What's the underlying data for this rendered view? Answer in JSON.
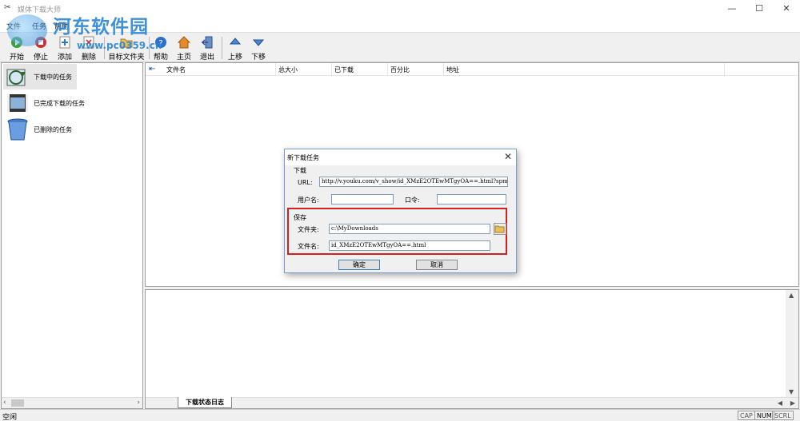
{
  "window": {
    "title": "媒体下载大师",
    "watermark": "河东软件园",
    "watermark_url": "www.pc0359.cn",
    "controls": [
      "—",
      "☐",
      "✕"
    ]
  },
  "menu": [
    "文件",
    "任务",
    "帮助"
  ],
  "toolbar": [
    {
      "label": "开始",
      "icon": "start-icon"
    },
    {
      "label": "停止",
      "icon": "stop-icon"
    },
    {
      "label": "添加",
      "icon": "add-icon"
    },
    {
      "label": "删除",
      "icon": "delete-icon"
    },
    {
      "label": "目标文件夹",
      "icon": "folder-icon"
    },
    {
      "label": "帮助",
      "icon": "help-icon"
    },
    {
      "label": "主页",
      "icon": "home-icon"
    },
    {
      "label": "退出",
      "icon": "exit-icon"
    },
    {
      "label": "上移",
      "icon": "up-arrow-icon"
    },
    {
      "label": "下移",
      "icon": "down-arrow-icon"
    }
  ],
  "sidebar": {
    "items": [
      {
        "label": "下载中的任务",
        "selected": true
      },
      {
        "label": "已完成下载的任务",
        "selected": false
      },
      {
        "label": "已删除的任务",
        "selected": false
      }
    ]
  },
  "list": {
    "columns": [
      "文件名",
      "总大小",
      "已下载",
      "百分比",
      "地址"
    ]
  },
  "log": {
    "tab_label": "下载状态日志"
  },
  "status": {
    "text": "空闲",
    "indicators": [
      "CAP",
      "NUM",
      "SCRL"
    ]
  },
  "dialog": {
    "title": "新下载任务",
    "close": "✕",
    "download_group": "下载",
    "url_label": "URL:",
    "url_value": "http://v.youku.com/v_show/id_XMzE2OTEwMTgyOA==.html?spm",
    "user_label": "用户名:",
    "user_value": "",
    "password_label": "口令:",
    "password_value": "",
    "save_group": "保存",
    "folder_label": "文件夹:",
    "folder_value": "c:\\MyDownloads",
    "filename_label": "文件名:",
    "filename_value": "id_XMzE2OTEwMTgyOA==.html",
    "ok_label": "确定",
    "cancel_label": "取消"
  },
  "colors": {
    "highlight": "#d62020",
    "watermark": "#2a85d4"
  }
}
